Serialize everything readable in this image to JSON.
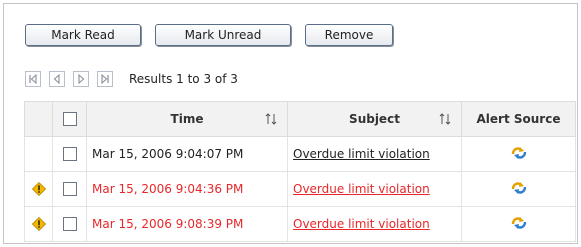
{
  "toolbar": {
    "mark_read_label": "Mark Read",
    "mark_unread_label": "Mark Unread",
    "remove_label": "Remove"
  },
  "pager": {
    "results_text": "Results 1 to 3 of 3",
    "icons": [
      "first-page-icon",
      "previous-page-icon",
      "next-page-icon",
      "last-page-icon"
    ]
  },
  "table": {
    "columns": {
      "time": "Time",
      "subject": "Subject",
      "source": "Alert Source"
    },
    "rows": [
      {
        "flag": false,
        "time": "Mar 15, 2006 9:04:07 PM",
        "subject": "Overdue limit violation",
        "source_icon": "alert-source-icon",
        "color": "#222222"
      },
      {
        "flag": true,
        "time": "Mar 15, 2006 9:04:36 PM",
        "subject": "Overdue limit violation",
        "source_icon": "alert-source-icon",
        "color": "#e8282a"
      },
      {
        "flag": true,
        "time": "Mar 15, 2006 9:08:39 PM",
        "subject": "Overdue limit violation",
        "source_icon": "alert-source-icon",
        "color": "#e8282a"
      }
    ]
  },
  "colors": {
    "unread_red": "#e8282a",
    "header_bg": "#f2f2f2",
    "warning_amber": "#f2b800"
  }
}
